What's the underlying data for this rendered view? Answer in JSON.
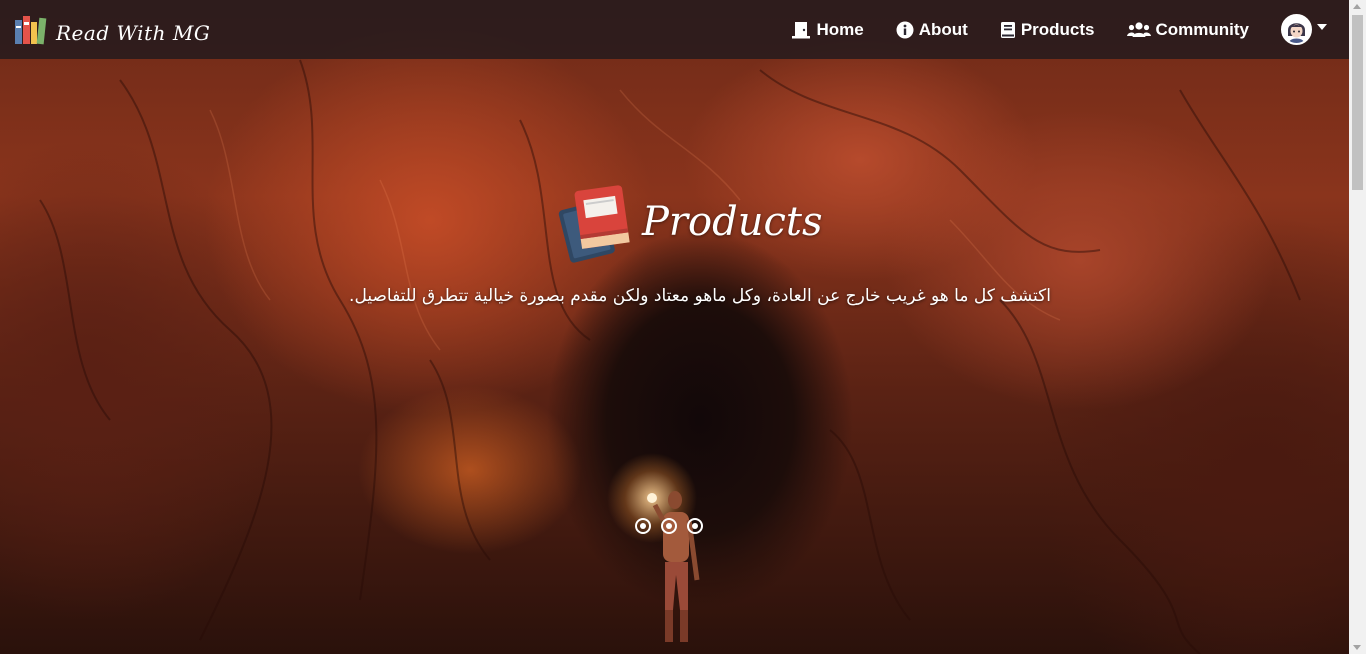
{
  "brand": {
    "name": "Read With MG",
    "icon": "books-icon"
  },
  "nav": {
    "items": [
      {
        "label": "Home",
        "icon": "door-icon"
      },
      {
        "label": "About",
        "icon": "info-circle-icon"
      },
      {
        "label": "Products",
        "icon": "book-icon"
      },
      {
        "label": "Community",
        "icon": "users-icon"
      }
    ],
    "profile_icon": "user-avatar-icon"
  },
  "hero": {
    "title": "Products",
    "subtitle": "اكتشف كل ما هو غريب خارج عن العادة، وكل ماهو معتاد ولكن مقدم بصورة خيالية تتطرق للتفاصيل.",
    "slide_count": 3
  },
  "colors": {
    "navbar": "#1c181e",
    "text": "#ffffff",
    "accent_red": "#d9443c",
    "accent_navy": "#2f4763"
  }
}
